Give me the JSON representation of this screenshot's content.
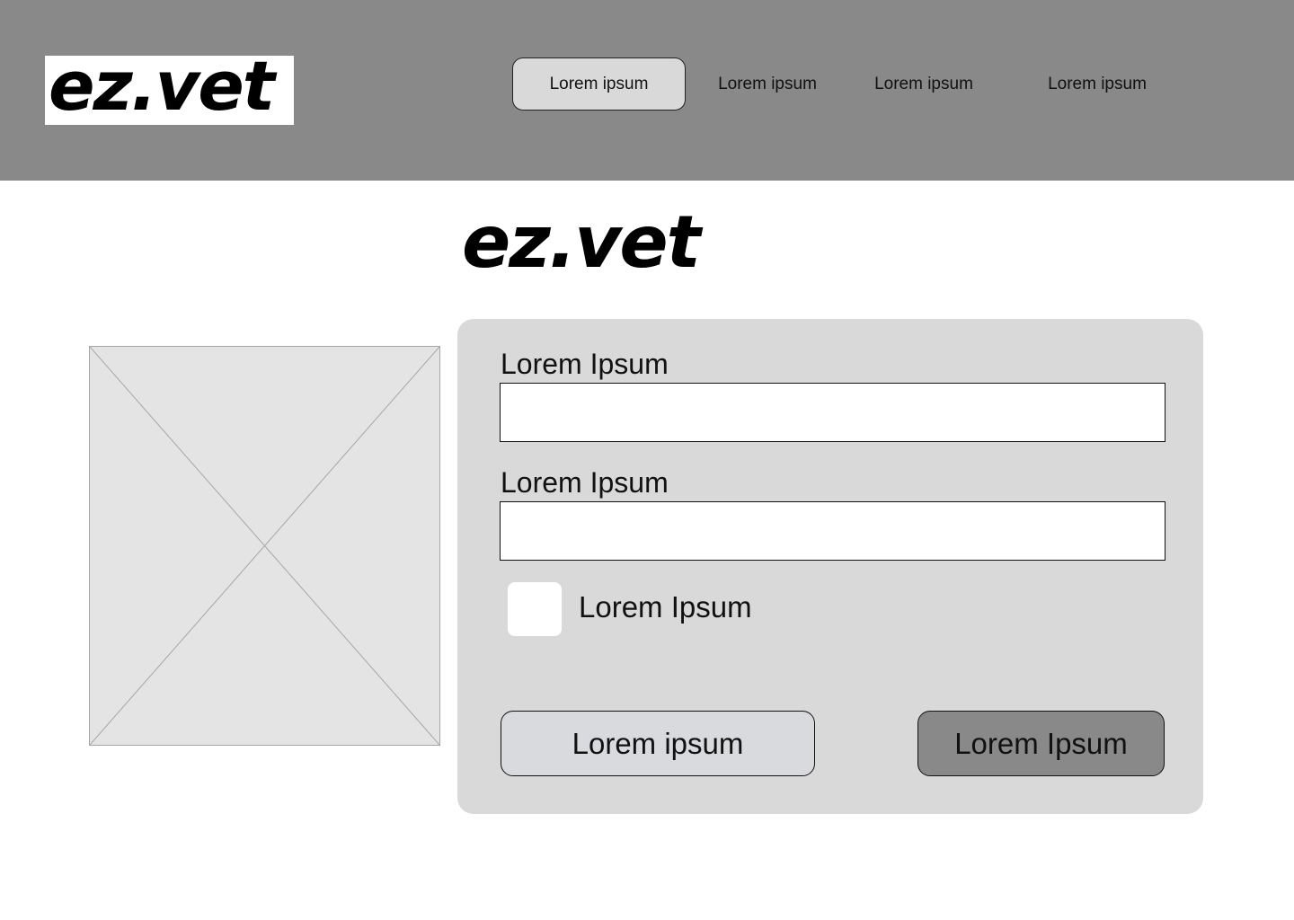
{
  "header": {
    "logo": "ez.vet",
    "nav": [
      {
        "label": "Lorem ipsum",
        "active": true
      },
      {
        "label": "Lorem ipsum",
        "active": false
      },
      {
        "label": "Lorem ipsum",
        "active": false
      },
      {
        "label": "Lorem ipsum",
        "active": false
      }
    ]
  },
  "main": {
    "logo": "ez.vet",
    "image": {
      "icon": "image-placeholder-icon"
    },
    "form": {
      "field1": {
        "label": "Lorem Ipsum",
        "value": ""
      },
      "field2": {
        "label": "Lorem Ipsum",
        "value": ""
      },
      "checkbox": {
        "label": "Lorem Ipsum",
        "checked": false
      },
      "secondary_button": "Lorem ipsum",
      "primary_button": "Lorem Ipsum"
    }
  },
  "colors": {
    "header_bg": "#898989",
    "card_bg": "#d9d9d9",
    "primary_button_bg": "#898989",
    "secondary_button_bg": "#d9dade",
    "placeholder_bg": "#e4e4e4"
  }
}
